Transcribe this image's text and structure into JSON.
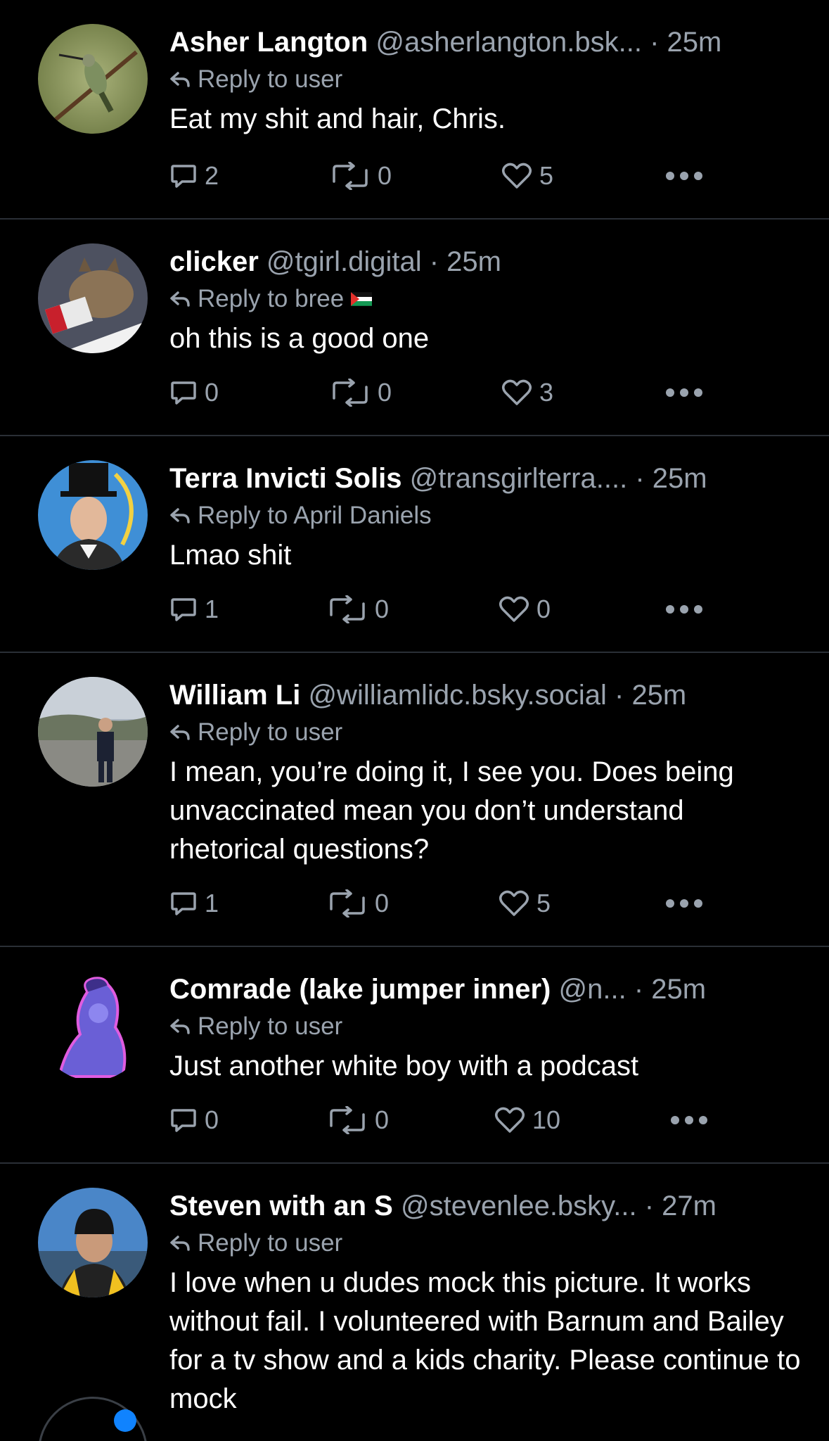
{
  "posts": [
    {
      "name": "Asher Langton",
      "handle": "@asherlangton.bsk...",
      "time": "25m",
      "reply_to": "Reply to user",
      "text": "Eat my shit and hair, Chris.",
      "replies": "2",
      "reposts": "0",
      "likes": "5"
    },
    {
      "name": "clicker",
      "handle": "@tgirl.digital",
      "time": "25m",
      "reply_to": "Reply to bree",
      "text": "oh this is a good one",
      "replies": "0",
      "reposts": "0",
      "likes": "3"
    },
    {
      "name": "Terra Invicti Solis",
      "handle": "@transgirlterra....",
      "time": "25m",
      "reply_to": "Reply to April Daniels",
      "text": "Lmao shit",
      "replies": "1",
      "reposts": "0",
      "likes": "0"
    },
    {
      "name": "William Li",
      "handle": "@williamlidc.bsky.social",
      "time": "25m",
      "reply_to": "Reply to user",
      "text": "I mean, you’re doing it, I see you. Does being unvaccinated mean you don’t understand rhetorical questions?",
      "replies": "1",
      "reposts": "0",
      "likes": "5"
    },
    {
      "name": "Comrade (lake jumper inner)",
      "handle": "@n...",
      "time": "25m",
      "reply_to": "Reply to user",
      "text": "Just another white boy with a podcast",
      "replies": "0",
      "reposts": "0",
      "likes": "10"
    },
    {
      "name": "Steven with an S",
      "handle": "@stevenlee.bsky...",
      "time": "27m",
      "reply_to": "Reply to user",
      "text": "I love when u dudes mock this picture.  It works without fail. I volunteered with Barnum and Bailey for a tv show and a kids charity.  Please continue to mock"
    }
  ],
  "separator": "·",
  "icons": {
    "reply": "reply-arrow-icon",
    "comment": "speech-bubble-icon",
    "repost": "repost-arrows-icon",
    "like": "heart-icon",
    "more": "ellipsis-icon"
  },
  "colors": {
    "background": "#000000",
    "muted_text": "#9aa3ae",
    "divider": "#2a2f36",
    "accent": "#1083fe"
  }
}
